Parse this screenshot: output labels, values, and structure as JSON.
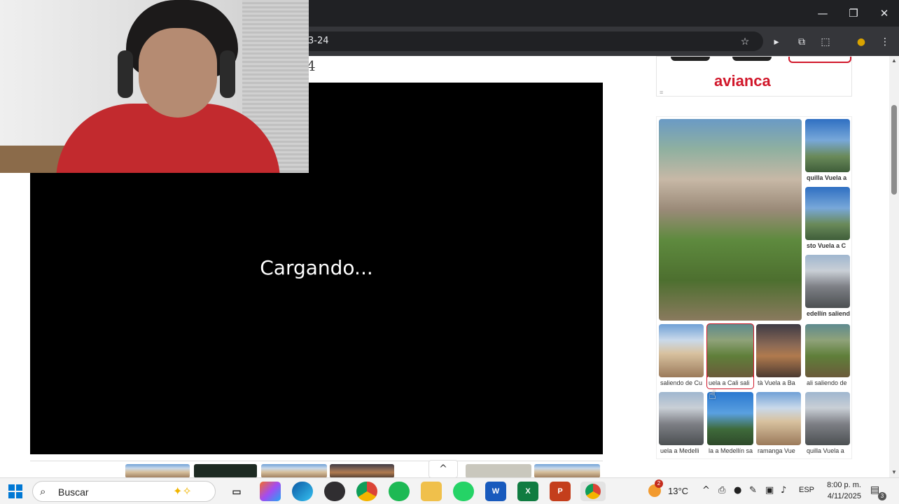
{
  "browser": {
    "url_fragment": "3-24",
    "window_controls": {
      "minimize": "—",
      "restore": "❐",
      "close": "✕"
    },
    "toolbar_icons": [
      "bookmark-star-icon",
      "play-extension-icon",
      "tab-search-icon",
      "extensions-icon",
      "profile-avatar-icon",
      "menu-kebab-icon"
    ]
  },
  "page": {
    "heading_fragment": "4",
    "video": {
      "loading_text": "Cargando..."
    },
    "strip_up_glyph": "^"
  },
  "ad": {
    "brand": "avianca",
    "info_glyph": "≡"
  },
  "gallery": {
    "captions": {
      "t1": "quilla   Vuela a",
      "t2": "sto   Vuela a C",
      "t3": "edellín  saliendo",
      "r1c1": "saliendo de Cu",
      "r1c2": "uela a Cali sali",
      "r1c3": "tà    Vuela a Ba",
      "r1c4": "ali saliendo de",
      "r2c1": "uela a Medelli",
      "r2c2": "la a Medellín sa",
      "r2c3": "ramanga   Vue",
      "r2c4": "quilla   Vuela a"
    }
  },
  "taskbar": {
    "search_placeholder": "Buscar",
    "apps": [
      "task-view",
      "copilot",
      "edge",
      "obs",
      "chrome",
      "spotify",
      "file-explorer",
      "whatsapp",
      "word",
      "excel",
      "powerpoint",
      "chrome-active"
    ],
    "weather": {
      "temp": "13°C",
      "badge": "2"
    },
    "language": "ESP",
    "clock": {
      "time": "8:00 p. m.",
      "date": "4/11/2025"
    },
    "notifications_badge": "3"
  },
  "colors": {
    "avianca_red": "#d1172a",
    "chrome_dark": "#202124",
    "taskbar_bg": "#f3f3f3"
  }
}
